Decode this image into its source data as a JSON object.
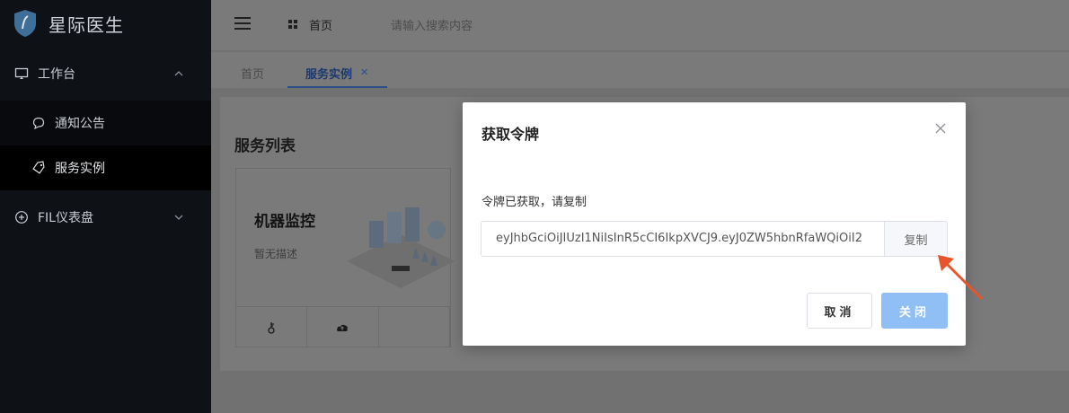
{
  "brand": {
    "name": "星际医生",
    "logo_icon": "doctor-shield-logo"
  },
  "sidebar": {
    "groups": [
      {
        "label": "工作台",
        "icon": "monitor-icon",
        "expanded": true,
        "items": [
          {
            "label": "通知公告",
            "icon": "chat-bubble-icon",
            "active": false
          },
          {
            "label": "服务实例",
            "icon": "tag-icon",
            "active": true
          }
        ]
      },
      {
        "label": "FIL仪表盘",
        "icon": "plus-circle-icon",
        "expanded": false,
        "items": []
      }
    ]
  },
  "topbar": {
    "home_label": "首页",
    "search_placeholder": "请输入搜索内容"
  },
  "tabs": [
    {
      "label": "首页",
      "active": false
    },
    {
      "label": "服务实例",
      "active": true,
      "closable": true
    }
  ],
  "content": {
    "section_title": "服务列表",
    "card": {
      "title": "机器监控",
      "desc": "暂无描述",
      "action_icons": [
        "key-icon",
        "cloud-upload-icon"
      ]
    }
  },
  "modal": {
    "title": "获取令牌",
    "message": "令牌已获取，请复制",
    "token_value": "eyJhbGciOiJIUzI1NiIsInR5cCI6IkpXVCJ9.eyJ0ZW5hbnRfaWQiOiI2",
    "copy_label": "复制",
    "cancel_label": "取消",
    "close_label": "关闭"
  },
  "colors": {
    "sidebar_bg": "#0e1116",
    "primary_btn": "#8fbff5",
    "annotation_arrow": "#e8552b"
  }
}
